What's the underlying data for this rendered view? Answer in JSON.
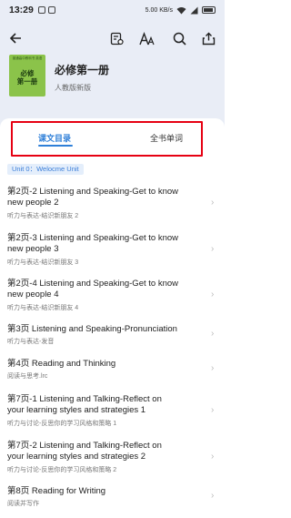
{
  "status_bar": {
    "time": "13:29",
    "right_text": "5.00 KB/s"
  },
  "book": {
    "cover_top_text": "普通高中教科书 英语",
    "cover_title_line1": "必修",
    "cover_title_line2": "第一册",
    "title": "必修第一册",
    "publisher": "人教版新版"
  },
  "tabs": {
    "active": "课文目录",
    "inactive": "全书单词"
  },
  "unit_label": "Unit 0：Welocme Unit",
  "lessons": [
    {
      "title_line1": "第2页-2 Listening and Speaking-Get to know",
      "title_line2": "new people 2",
      "subtitle": "听力与表达-结识新朋友 2"
    },
    {
      "title_line1": "第2页-3 Listening and Speaking-Get to know",
      "title_line2": "new people 3",
      "subtitle": "听力与表达-结识新朋友 3"
    },
    {
      "title_line1": "第2页-4 Listening and Speaking-Get to know",
      "title_line2": "new people 4",
      "subtitle": "听力与表达-结识新朋友 4"
    },
    {
      "title_line1": "第3页 Listening and Speaking-Pronunciation",
      "title_line2": "",
      "subtitle": "听力与表达-发音"
    },
    {
      "title_line1": "第4页 Reading and Thinking",
      "title_line2": "",
      "subtitle": "阅读与思考.lrc"
    },
    {
      "title_line1": "第7页-1 Listening and Talking-Reflect on",
      "title_line2": "your learning styles and strategies 1",
      "subtitle": "听力与讨论-反思你的学习风格和策略 1"
    },
    {
      "title_line1": "第7页-2 Listening and Talking-Reflect on",
      "title_line2": "your learning styles and strategies 2",
      "subtitle": "听力与讨论-反思你的学习风格和策略 2"
    },
    {
      "title_line1": "第8页 Reading for Writing",
      "title_line2": "",
      "subtitle": "阅读并写作"
    }
  ],
  "colors": {
    "accent": "#2e7fd8",
    "highlight_border": "#e60012",
    "cover_green": "#8bc34a"
  }
}
